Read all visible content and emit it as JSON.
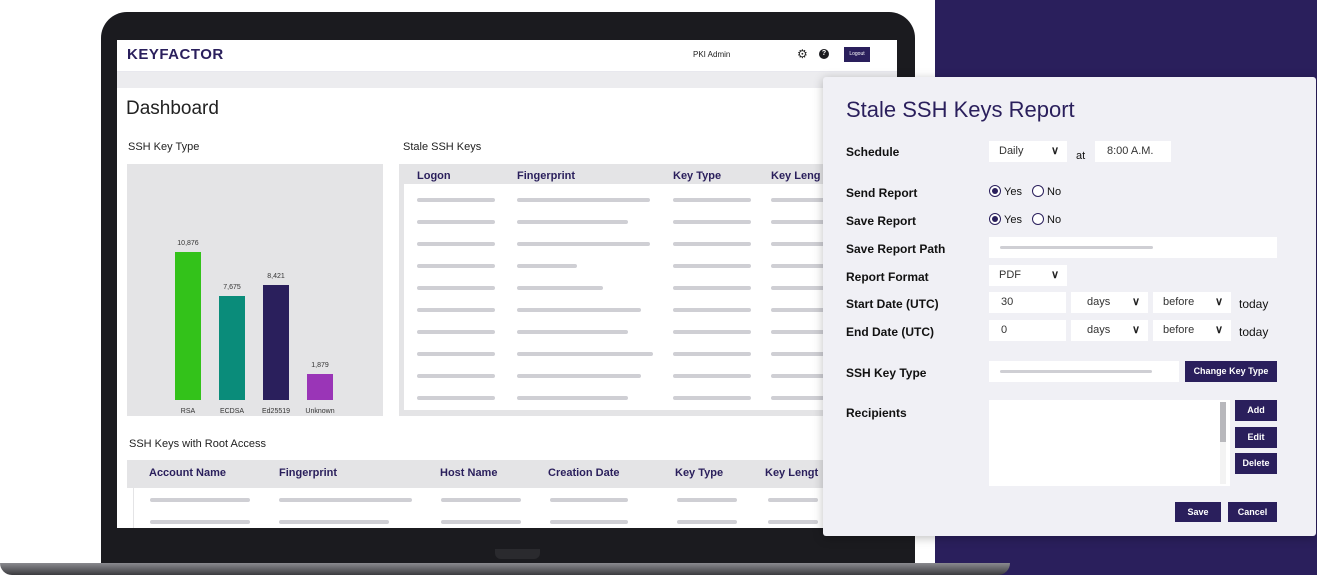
{
  "app": {
    "brand": "KEYFACTOR",
    "user": "PKI Admin",
    "logout_label": "Logout",
    "page_title": "Dashboard"
  },
  "ssh_key_type": {
    "heading": "SSH Key Type",
    "chart_data": {
      "type": "bar",
      "categories": [
        "RSA",
        "ECDSA",
        "Ed25519",
        "Unknown"
      ],
      "values": [
        10876,
        7675,
        8421,
        1879
      ],
      "value_labels": [
        "10,876",
        "7,675",
        "8,421",
        "1,879"
      ],
      "colors": [
        "#33c21a",
        "#0a8c7a",
        "#2a1f5c",
        "#9a35b7"
      ],
      "title": "",
      "xlabel": "",
      "ylabel": "",
      "grid": false
    }
  },
  "stale": {
    "heading": "Stale SSH Keys",
    "columns": [
      "Logon",
      "Fingerprint",
      "Key Type",
      "Key Leng"
    ]
  },
  "root": {
    "heading": "SSH Keys with Root Access",
    "columns": [
      "Account Name",
      "Fingerprint",
      "Host Name",
      "Creation Date",
      "Key Type",
      "Key Lengt"
    ]
  },
  "dialog": {
    "title": "Stale SSH Keys Report",
    "schedule_label": "Schedule",
    "schedule_value": "Daily",
    "at_label": "at",
    "time_value": "8:00 A.M.",
    "send_report_label": "Send Report",
    "save_report_label": "Save Report",
    "yes": "Yes",
    "no": "No",
    "save_path_label": "Save Report Path",
    "report_format_label": "Report Format",
    "report_format_value": "PDF",
    "start_date_label": "Start Date (UTC)",
    "start_value": "30",
    "end_date_label": "End Date (UTC)",
    "end_value": "0",
    "unit_value": "days",
    "relation_value": "before",
    "today_label": "today",
    "ssh_key_type_label": "SSH Key Type",
    "change_key_type_label": "Change Key Type",
    "recipients_label": "Recipients",
    "add_label": "Add",
    "edit_label": "Edit",
    "delete_label": "Delete",
    "save_label": "Save",
    "cancel_label": "Cancel",
    "send_report_selected": "Yes",
    "save_report_selected": "Yes"
  },
  "colors": {
    "accent": "#2a1f5c",
    "panel_bg": "#e4e4e6"
  }
}
